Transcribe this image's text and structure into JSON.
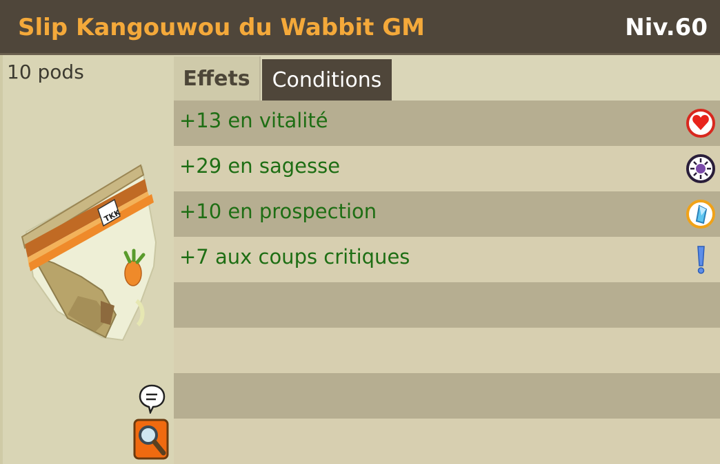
{
  "header": {
    "item_name": "Slip Kangouwou du Wabbit GM",
    "level": "Niv.60"
  },
  "item": {
    "weight": "10 pods",
    "image_icon": "kangaroo-underpants-item-icon"
  },
  "tabs": [
    {
      "label": "Effets",
      "active": true
    },
    {
      "label": "Conditions",
      "active": false
    }
  ],
  "effects": [
    {
      "text": "+13 en vitalité",
      "icon": "heart-icon"
    },
    {
      "text": "+29 en sagesse",
      "icon": "wisdom-icon"
    },
    {
      "text": "+10 en prospection",
      "icon": "crystal-icon"
    },
    {
      "text": "+7 aux coups critiques",
      "icon": "exclamation-icon"
    },
    {
      "text": "",
      "icon": ""
    },
    {
      "text": "",
      "icon": ""
    },
    {
      "text": "",
      "icon": ""
    },
    {
      "text": "",
      "icon": ""
    }
  ],
  "colors": {
    "title_orange": "#f4a93a",
    "header_dark": "#4f463a",
    "effect_green": "#1e6e14",
    "row_dark": "#b6ae91",
    "row_light": "#d7cfb0"
  }
}
